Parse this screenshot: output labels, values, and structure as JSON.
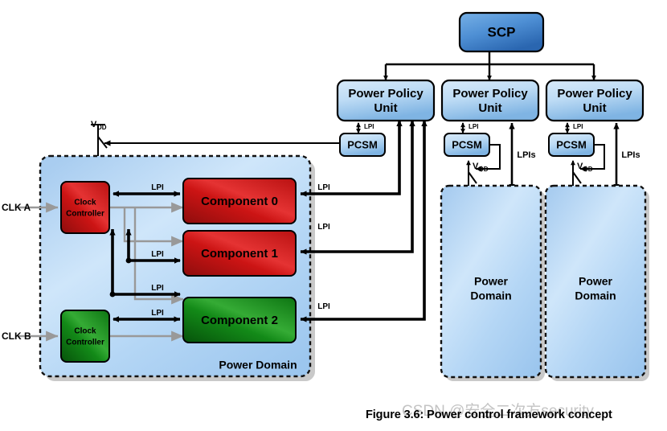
{
  "figure": {
    "caption": "Figure 3.6: Power control framework concept",
    "watermark": "CSDN @安全二次方security"
  },
  "colors": {
    "blue_light_top": "#cfe4f7",
    "blue_light_bottom": "#7fb4e3",
    "blue_dark_top": "#5f9fdd",
    "blue_dark_bottom": "#2f6fb8",
    "domain_fill_top": "#a9cdf0",
    "domain_fill_bottom": "#bcd9f5",
    "red_top": "#e02020",
    "red_bottom": "#9b0f0f",
    "green_top": "#1f9a1f",
    "green_bottom": "#0a5c0a",
    "arrow_black": "#000000",
    "arrow_grey": "#999999",
    "shadow": "#c9c9c9"
  },
  "scp": {
    "label": "SCP"
  },
  "power_policy_units": [
    {
      "label": "Power Policy Unit"
    },
    {
      "label": "Power Policy Unit"
    },
    {
      "label": "Power Policy Unit"
    }
  ],
  "pcsm_blocks": [
    {
      "label": "PCSM"
    },
    {
      "label": "PCSM"
    },
    {
      "label": "PCSM"
    }
  ],
  "ppu_lpi_labels": [
    "LPI",
    "LPI",
    "LPI"
  ],
  "lpis_labels": [
    "LPIs",
    "LPIs"
  ],
  "vdd_labels": [
    {
      "main": "V",
      "sub": "DD"
    },
    {
      "main": "V",
      "sub": "DD"
    },
    {
      "main": "V",
      "sub": "DD"
    }
  ],
  "left_domain": {
    "label": "Power Domain",
    "clock_inputs": [
      {
        "label": "CLK A"
      },
      {
        "label": "CLK B"
      }
    ],
    "clock_controllers": [
      {
        "line1": "Clock",
        "line2": "Controller",
        "color": "red"
      },
      {
        "line1": "Clock",
        "line2": "Controller",
        "color": "green"
      }
    ],
    "components": [
      {
        "label": "Component 0",
        "color": "red"
      },
      {
        "label": "Component 1",
        "color": "red"
      },
      {
        "label": "Component 2",
        "color": "green"
      }
    ],
    "internal_lpi_labels": [
      "LPI",
      "LPI",
      "LPI",
      "LPI"
    ],
    "external_lpi_labels": [
      "LPI",
      "LPI",
      "LPI"
    ]
  },
  "right_domains": [
    {
      "line1": "Power",
      "line2": "Domain"
    },
    {
      "line1": "Power",
      "line2": "Domain"
    }
  ]
}
